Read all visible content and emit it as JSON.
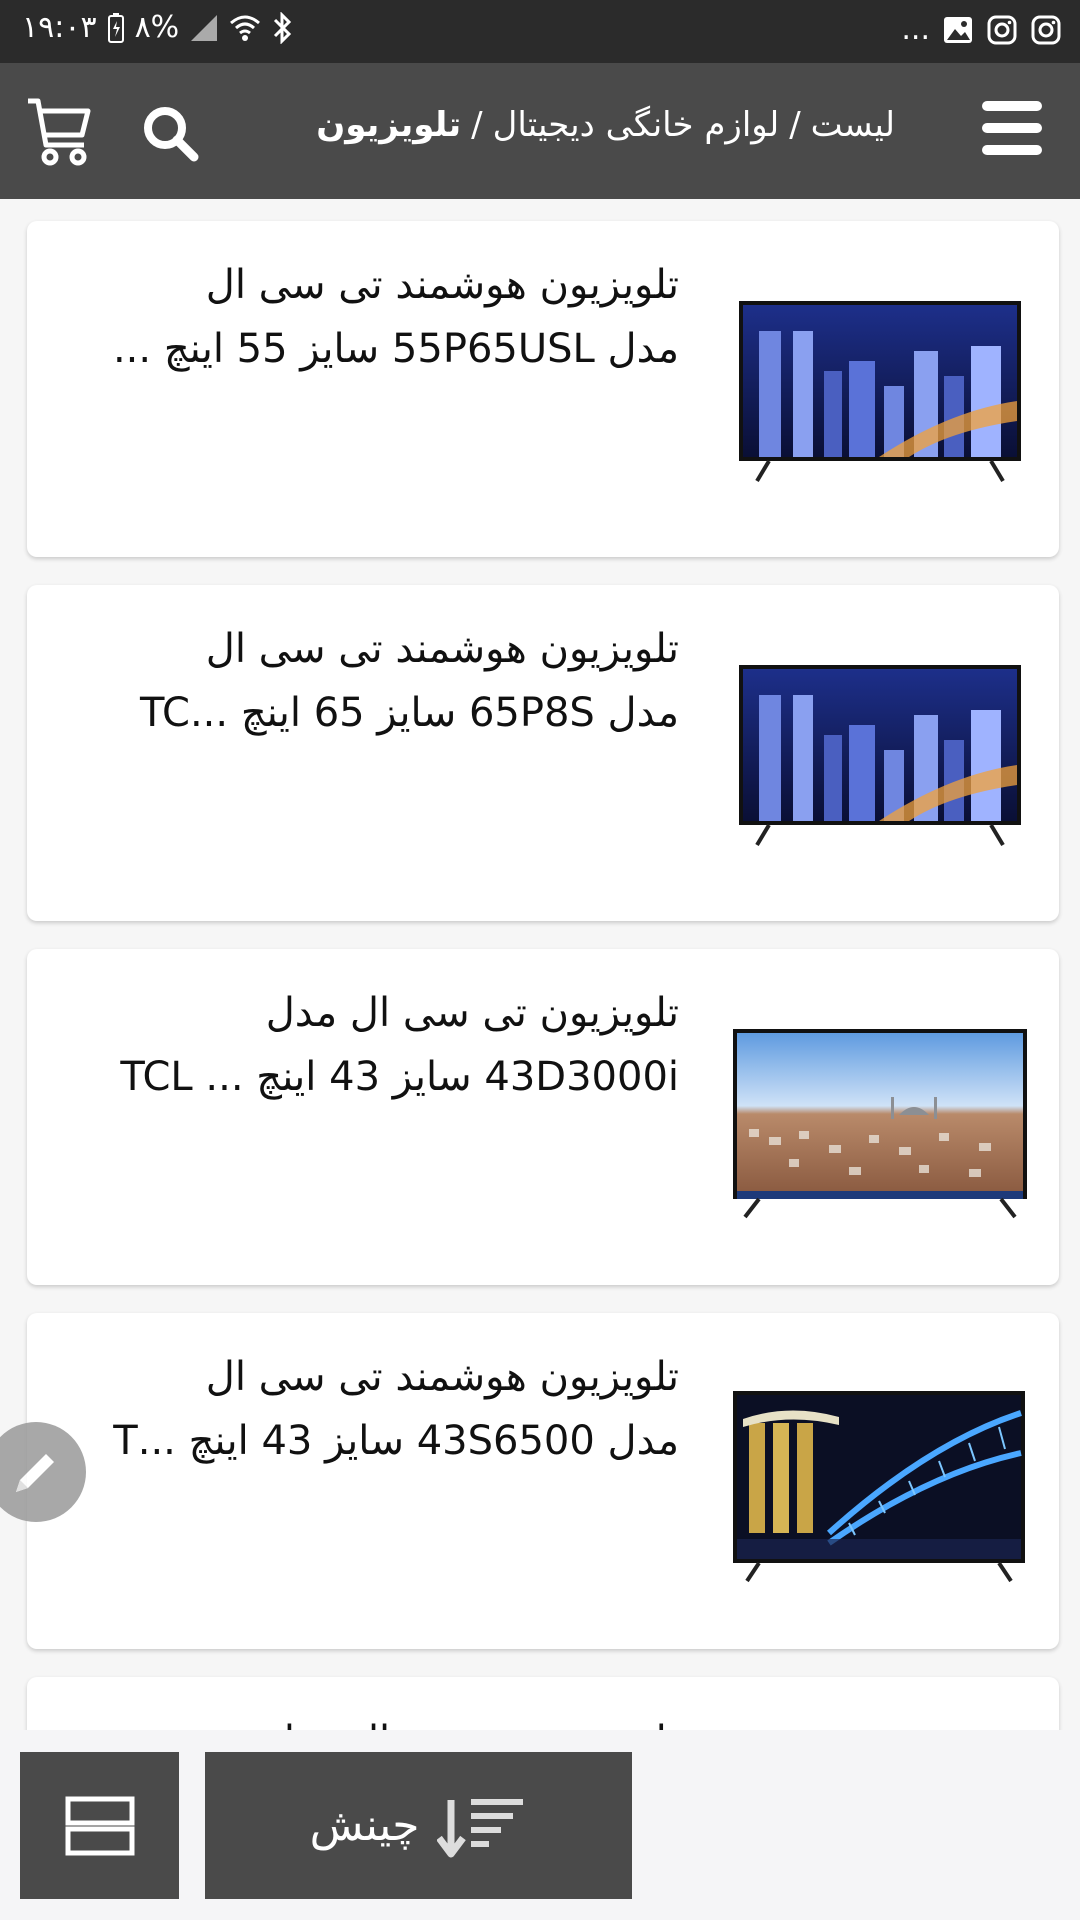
{
  "status_bar": {
    "time": "۱۹:۰۳",
    "battery": "۸%",
    "more": "...",
    "icons": [
      "battery-icon",
      "signal-icon",
      "wifi-icon",
      "bluetooth-icon",
      "gallery-icon",
      "instagram-icon",
      "instagram-icon"
    ]
  },
  "app_bar": {
    "breadcrumb": {
      "parts": [
        "لیست",
        "لوازم خانگی دیجیتال"
      ],
      "separator": "/",
      "current": "تلویزیون"
    }
  },
  "products": [
    {
      "title": "تلویزیون هوشمند تی سی ال\nمدل 55P65USL سایز 55 اینچ ...",
      "thumb": "tv-city-night"
    },
    {
      "title": "تلویزیون هوشمند تی سی ال\nمدل 65P8S سایز 65 اینچ ...TC",
      "thumb": "tv-city-night"
    },
    {
      "title": "تلویزیون تی سی ال مدل\n43D3000i سایز 43 اینچ ... TCL",
      "thumb": "tv-city-day"
    },
    {
      "title": "تلویزیون هوشمند تی سی ال\nمدل 43S6500 سایز 43 اینچ ...T",
      "thumb": "tv-bridge-night"
    },
    {
      "title": "تلویزیون تی سی ال مدل",
      "thumb": "tv-city-night"
    }
  ],
  "bottom_bar": {
    "sort_label": "چینش"
  },
  "colors": {
    "status_bg": "#2b2b2b",
    "appbar_bg": "#4a4a4a",
    "page_bg": "#f6f6f6",
    "card_bg": "#ffffff"
  }
}
